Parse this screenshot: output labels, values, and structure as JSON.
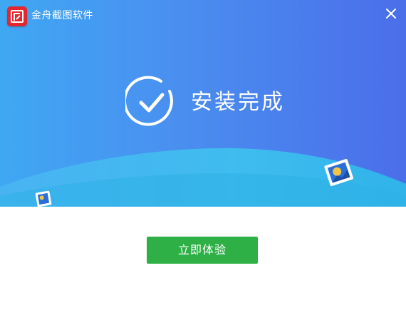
{
  "window": {
    "title": "金舟截图软件",
    "close_icon": "close-icon",
    "logo_icon": "app-logo-icon"
  },
  "hero": {
    "status_text": "安装完成",
    "status_icon": "check-circle-icon"
  },
  "actions": {
    "primary_label": "立即体验"
  },
  "colors": {
    "hero_gradient_start": "#3fa8f3",
    "hero_gradient_end": "#4b6ee9",
    "wave_light": "#5cc8f4",
    "primary_button": "#2eb046",
    "logo_red": "#e4262d"
  }
}
